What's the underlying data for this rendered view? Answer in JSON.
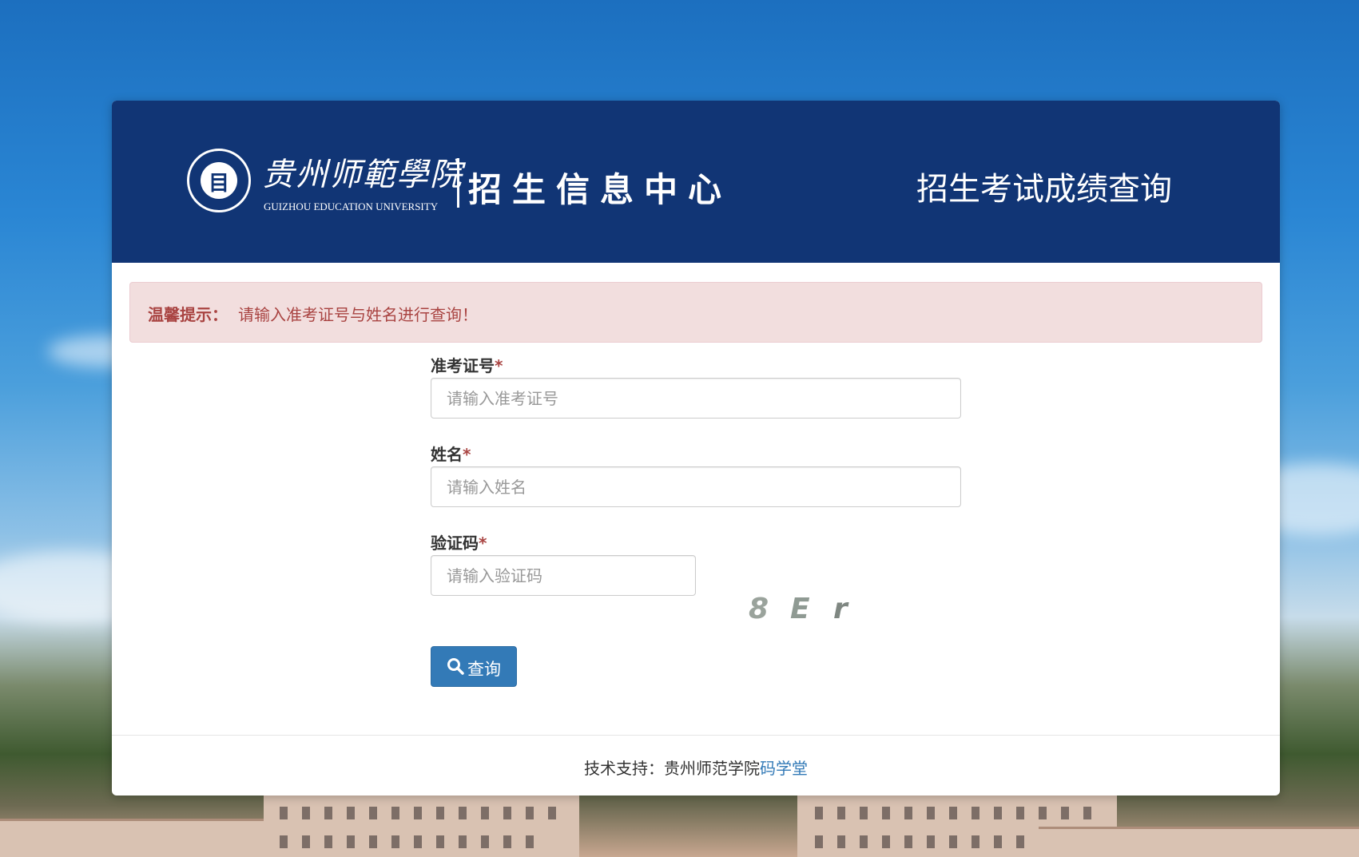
{
  "header": {
    "logo_cn": "贵州师範學院",
    "logo_en": "GUIZHOU EDUCATION UNIVERSITY",
    "logo_center": "招生信息中心",
    "title": "招生考试成绩查询"
  },
  "alert": {
    "label": "温馨提示：",
    "text": "请输入准考证号与姓名进行查询！"
  },
  "form": {
    "exam_id": {
      "label": "准考证号",
      "required_mark": "*",
      "placeholder": "请输入准考证号",
      "value": ""
    },
    "name": {
      "label": "姓名",
      "required_mark": "*",
      "placeholder": "请输入姓名",
      "value": ""
    },
    "captcha": {
      "label": "验证码",
      "required_mark": "*",
      "placeholder": "请输入验证码",
      "value": "",
      "chars": [
        "8",
        "E",
        "r"
      ]
    },
    "submit_label": "查询"
  },
  "footer": {
    "prefix": "技术支持：贵州师范学院",
    "link_text": "码学堂"
  },
  "colors": {
    "header_bg": "#113575",
    "alert_bg": "#f2dede",
    "alert_text": "#a94442",
    "primary": "#337ab7"
  },
  "icons": {
    "seal": "university-seal-icon",
    "search": "search-icon"
  }
}
